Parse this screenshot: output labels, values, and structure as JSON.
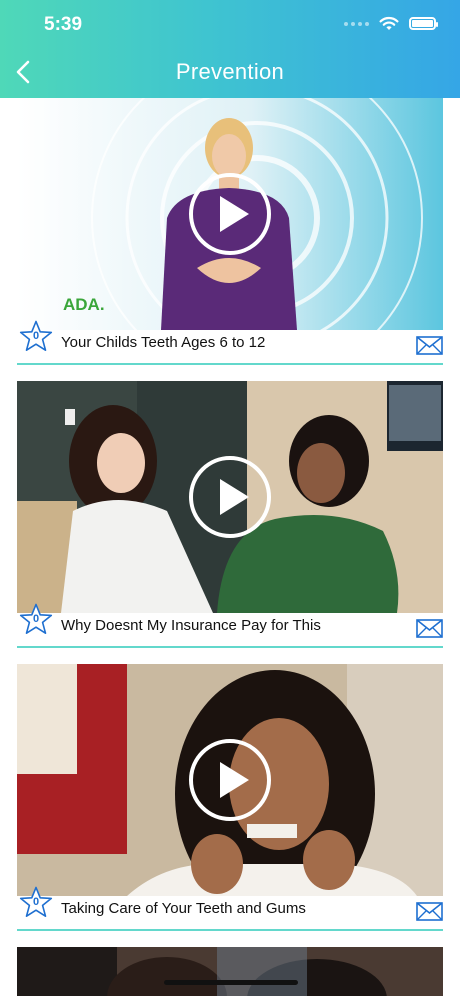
{
  "status_bar": {
    "time": "5:39"
  },
  "header": {
    "title": "Prevention",
    "back_icon": "chevron-left-icon"
  },
  "videos": [
    {
      "title": "Your Childs Teeth Ages 6 to 12",
      "stars": "0",
      "overlay_text": "ADA."
    },
    {
      "title": "Why Doesnt My Insurance Pay for This",
      "stars": "0"
    },
    {
      "title": "Taking Care of Your Teeth and Gums",
      "stars": "0"
    }
  ],
  "colors": {
    "header_start": "#4fd8b8",
    "header_end": "#35a6e6",
    "divider": "#63d8cc",
    "icon_blue": "#1e6fd0"
  }
}
